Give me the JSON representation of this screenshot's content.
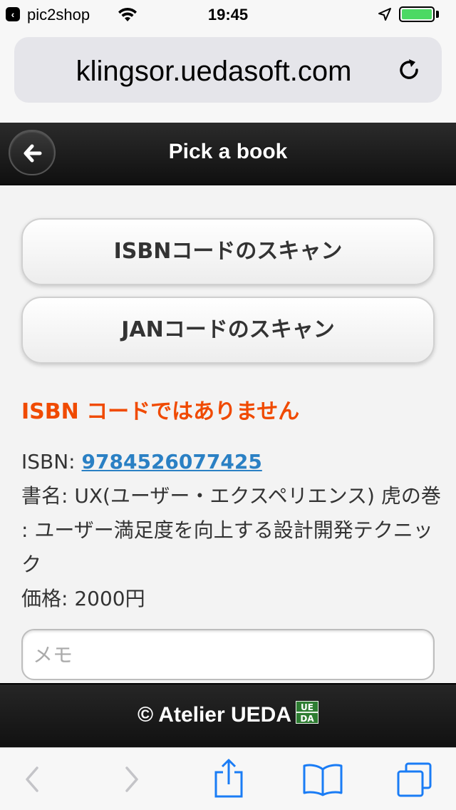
{
  "status_bar": {
    "app_name": "pic2shop",
    "time": "19:45",
    "back_glyph": "‹",
    "icons": [
      "back-to-app-icon",
      "wifi-icon",
      "location-arrow-icon",
      "battery-icon"
    ]
  },
  "browser": {
    "url": "klingsor.uedasoft.com",
    "reload_icon": "reload-icon"
  },
  "header": {
    "title": "Pick a book",
    "back_icon": "arrow-left-icon"
  },
  "main": {
    "scan_isbn_label": "ISBNコードのスキャン",
    "scan_jan_label": "JANコードのスキャン",
    "error_message": "ISBN コードではありません",
    "isbn_label": "ISBN: ",
    "isbn_value": "9784526077425",
    "title_line": "書名: UX(ユーザー・エクスペリエンス) 虎の巻 : ユーザー満足度を向上する設計開発テクニック",
    "price_line": "価格: 2000円",
    "memo_placeholder": "メモ",
    "memo_value": ""
  },
  "footer": {
    "copyright": "© Atelier UEDA",
    "logo_text": "UE DA"
  },
  "toolbar": {
    "icons": [
      "back-icon",
      "forward-icon",
      "share-icon",
      "bookmarks-icon",
      "tabs-icon"
    ]
  },
  "colors": {
    "accent_link": "#2a80c4",
    "error": "#f04a00",
    "ios_blue": "#1a7cf5",
    "battery": "#4cd964",
    "logo_green": "#2e7d32"
  }
}
